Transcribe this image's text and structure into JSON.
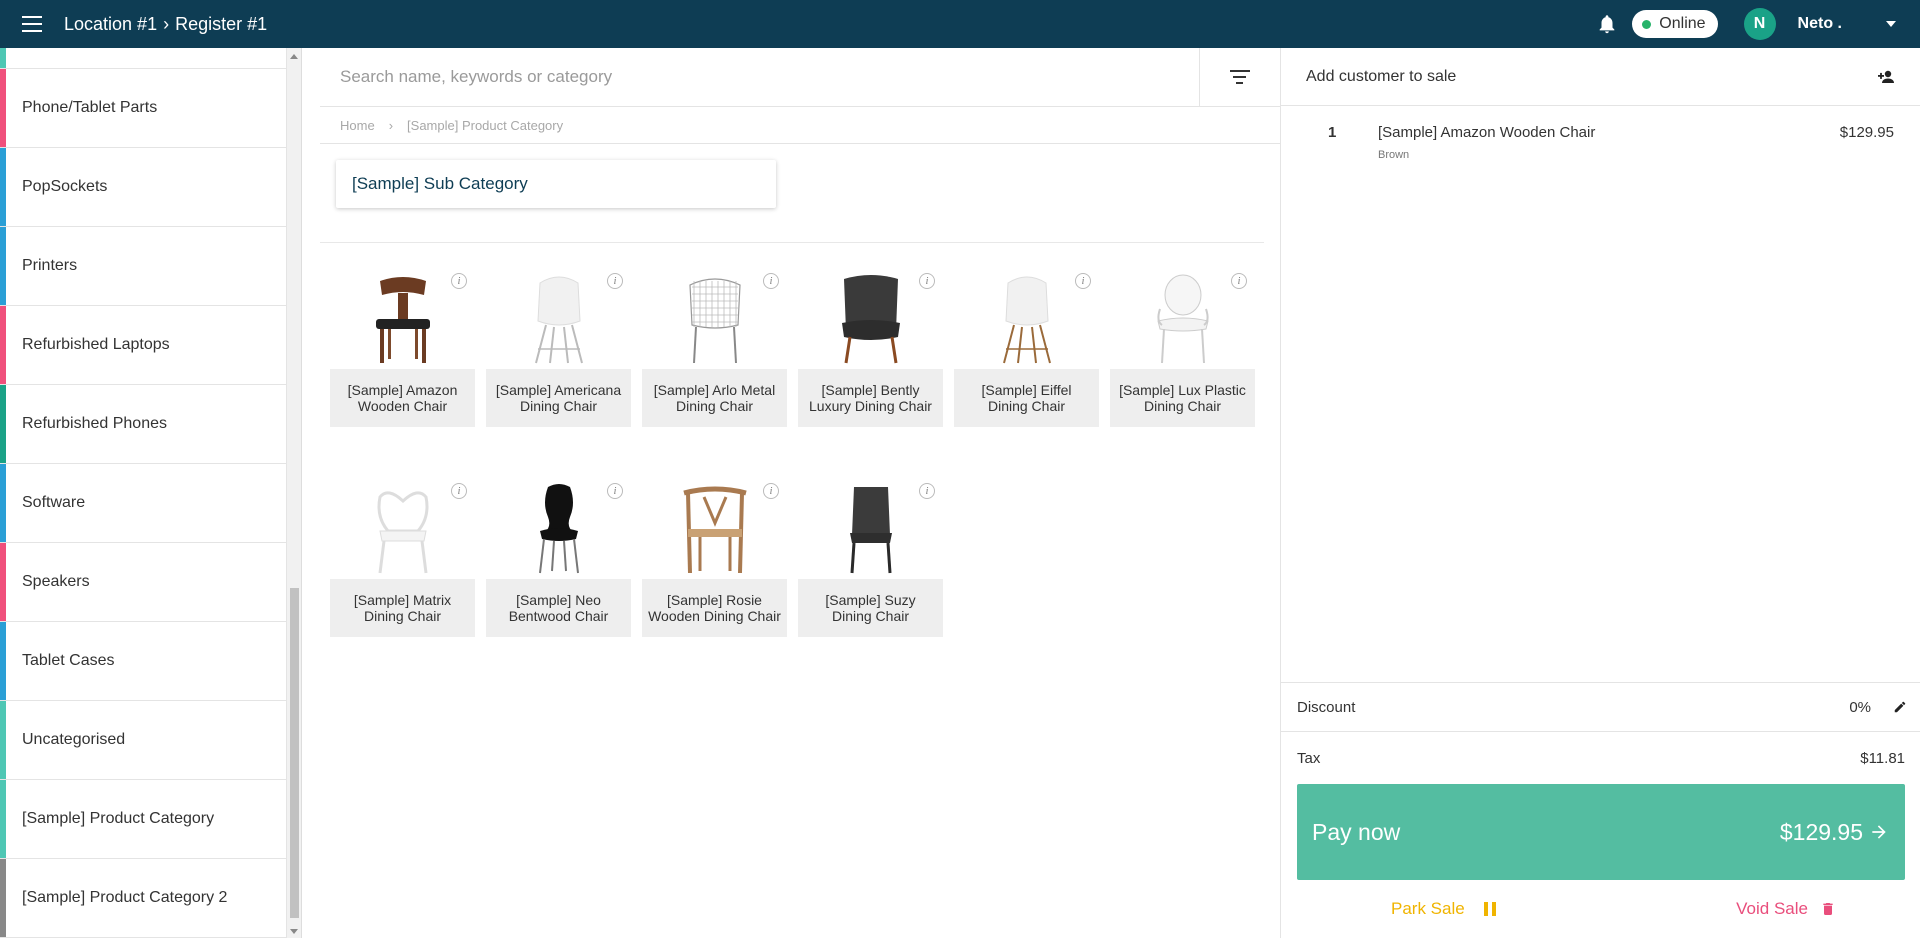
{
  "topbar": {
    "location": "Location #1",
    "separator": "›",
    "register": "Register #1",
    "status": "Online",
    "avatar_initial": "N",
    "user_name": "Neto ."
  },
  "sidebar": {
    "items": [
      {
        "label": "Phone/Tablet Parts",
        "color": "#f0507c"
      },
      {
        "label": "PopSockets",
        "color": "#2a9fd6"
      },
      {
        "label": "Printers",
        "color": "#2a9fd6"
      },
      {
        "label": "Refurbished Laptops",
        "color": "#f0507c"
      },
      {
        "label": "Refurbished Phones",
        "color": "#1aa287"
      },
      {
        "label": "Software",
        "color": "#2a9fd6"
      },
      {
        "label": "Speakers",
        "color": "#f0507c"
      },
      {
        "label": "Tablet Cases",
        "color": "#2a9fd6"
      },
      {
        "label": "Uncategorised",
        "color": "#4ec7b4"
      },
      {
        "label": "[Sample] Product Category",
        "color": "#4ec7b4"
      },
      {
        "label": "[Sample] Product Category 2",
        "color": "#888888"
      }
    ]
  },
  "search": {
    "placeholder": "Search name, keywords or category"
  },
  "breadcrumb": {
    "home": "Home",
    "separator": "›",
    "current": "[Sample] Product Category"
  },
  "subcategory": {
    "label": "[Sample] Sub Category"
  },
  "products": [
    {
      "name": "[Sample] Amazon Wooden Chair",
      "icon": "wooden-chair-icon"
    },
    {
      "name": "[Sample] Americana Dining Chair",
      "icon": "white-chair-icon"
    },
    {
      "name": "[Sample] Arlo Metal Dining Chair",
      "icon": "wire-chair-icon"
    },
    {
      "name": "[Sample] Bently Luxury Dining Chair",
      "icon": "dark-chair-icon"
    },
    {
      "name": "[Sample] Eiffel Dining Chair",
      "icon": "eiffel-chair-icon"
    },
    {
      "name": "[Sample] Lux Plastic Dining Chair",
      "icon": "clear-chair-icon"
    },
    {
      "name": "[Sample] Matrix Dining Chair",
      "icon": "matrix-chair-icon"
    },
    {
      "name": "[Sample] Neo Bentwood Chair",
      "icon": "black-chair-icon"
    },
    {
      "name": "[Sample] Rosie Wooden Dining Chair",
      "icon": "rosie-chair-icon"
    },
    {
      "name": "[Sample] Suzy Dining Chair",
      "icon": "suzy-chair-icon"
    }
  ],
  "cart": {
    "add_customer_label": "Add customer to sale",
    "items": [
      {
        "qty": "1",
        "name": "[Sample] Amazon Wooden Chair",
        "variant": "Brown",
        "price": "$129.95"
      }
    ],
    "discount_label": "Discount",
    "discount_value": "0%",
    "tax_label": "Tax",
    "tax_value": "$11.81",
    "pay_label": "Pay now",
    "pay_amount": "$129.95",
    "park_label": "Park Sale",
    "void_label": "Void Sale"
  },
  "colors": {
    "topbar": "#0e3d54",
    "pay": "#54bda1",
    "park": "#f0b400",
    "void": "#e94e7c"
  }
}
